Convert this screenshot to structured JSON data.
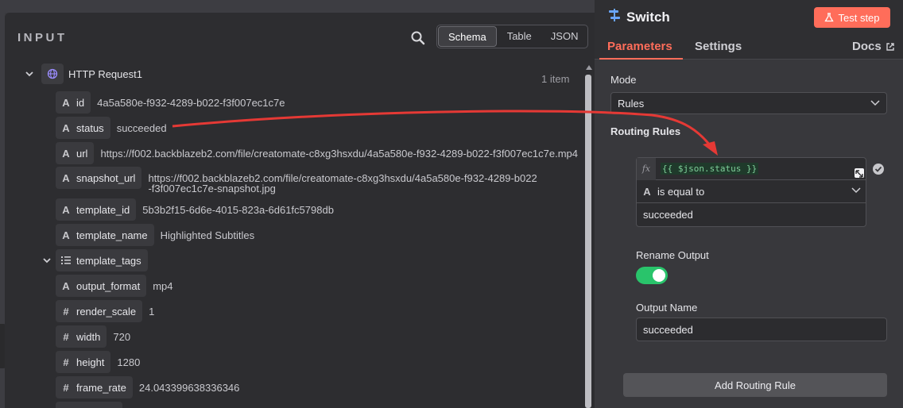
{
  "input": {
    "title": "INPUT",
    "views": [
      "Schema",
      "Table",
      "JSON"
    ],
    "active_view": "Schema",
    "node": {
      "name": "HTTP Request1",
      "count": "1 item"
    },
    "fields": [
      {
        "type": "A",
        "key": "id",
        "value": "4a5a580e-f932-4289-b022-f3f007ec1c7e"
      },
      {
        "type": "A",
        "key": "status",
        "value": "succeeded"
      },
      {
        "type": "A",
        "key": "url",
        "value": "https://f002.backblazeb2.com/file/creatomate-c8xg3hsxdu/4a5a580e-f932-4289-b022-f3f007ec1c7e.mp4"
      },
      {
        "type": "A",
        "key": "snapshot_url",
        "value": "https://f002.backblazeb2.com/file/creatomate-c8xg3hsxdu/4a5a580e-f932-4289-b022-f3f007ec1c7e-snapshot.jpg"
      },
      {
        "type": "A",
        "key": "template_id",
        "value": "5b3b2f15-6d6e-4015-823a-6d61fc5798db"
      },
      {
        "type": "A",
        "key": "template_name",
        "value": "Highlighted Subtitles"
      },
      {
        "type": "list",
        "key": "template_tags",
        "value": ""
      },
      {
        "type": "A",
        "key": "output_format",
        "value": "mp4"
      },
      {
        "type": "#",
        "key": "render_scale",
        "value": "1"
      },
      {
        "type": "#",
        "key": "width",
        "value": "720"
      },
      {
        "type": "#",
        "key": "height",
        "value": "1280"
      },
      {
        "type": "#",
        "key": "frame_rate",
        "value": "24.043399638336346"
      }
    ]
  },
  "params": {
    "node_name": "Switch",
    "test_label": "Test step",
    "tabs": {
      "parameters": "Parameters",
      "settings": "Settings",
      "docs": "Docs"
    },
    "mode_label": "Mode",
    "mode_value": "Rules",
    "routing_label": "Routing Rules",
    "rule": {
      "expression": "{{ $json.status }}",
      "operator_type": "A",
      "operator": "is equal to",
      "value": "succeeded"
    },
    "rename_output_label": "Rename Output",
    "rename_output": true,
    "output_name_label": "Output Name",
    "output_name": "succeeded",
    "add_rule_label": "Add Routing Rule"
  },
  "colors": {
    "accent": "#ff6d5a",
    "toggle_on": "#29c46b",
    "expression_text": "#7fcf9a"
  }
}
